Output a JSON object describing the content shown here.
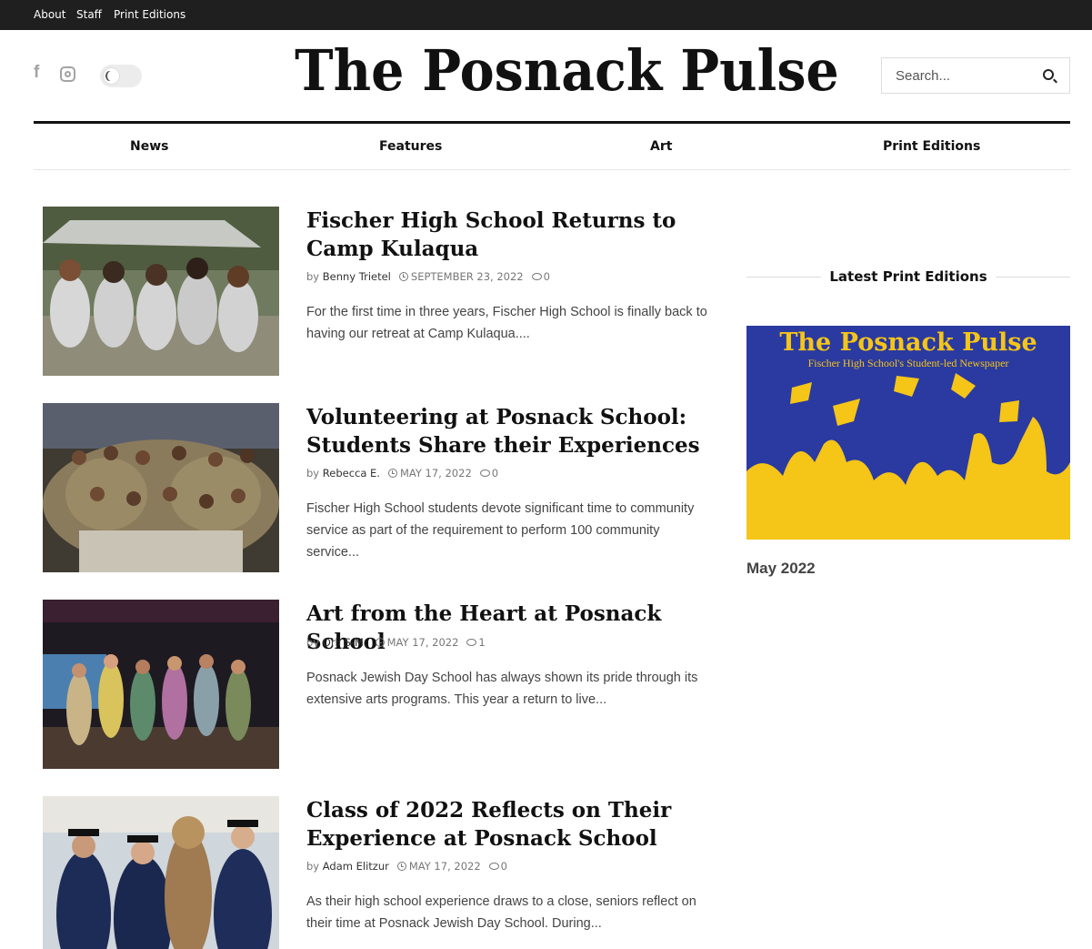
{
  "topbar": {
    "links": [
      "About",
      "Staff",
      "Print Editions"
    ]
  },
  "header": {
    "logo_text": "The Posnack Pulse",
    "search_placeholder": "Search...",
    "social_icons": [
      "facebook-icon",
      "instagram-icon"
    ],
    "dark_mode_toggle": "off"
  },
  "nav": {
    "items": [
      "News",
      "Features",
      "Art",
      "Print Editions"
    ]
  },
  "articles": [
    {
      "title": "Fischer High School Returns to Camp Kulaqua",
      "by": "by",
      "author": "Benny Trietel",
      "date": "SEPTEMBER 23, 2022",
      "comments": "0",
      "excerpt": "For the first time in three years, Fischer High School is finally back to having our retreat at Camp Kulaqua...."
    },
    {
      "title": "Volunteering at Posnack School: Students Share their Experiences",
      "by": "by",
      "author": "Rebecca E.",
      "date": "MAY 17, 2022",
      "comments": "0",
      "excerpt": "Fischer High School students devote significant time to community service as part of the requirement to perform 100 community service..."
    },
    {
      "title": "Art from the Heart at Posnack School",
      "by": "by",
      "author": "Orli S-M.",
      "date": "MAY 17, 2022",
      "comments": "1",
      "excerpt": "Posnack Jewish Day School has always shown its pride through its extensive arts programs. This year a return to live..."
    },
    {
      "title": "Class of 2022 Reflects on Their Experience at Posnack School",
      "by": "by",
      "author": "Adam Elitzur",
      "date": "MAY 17, 2022",
      "comments": "0",
      "excerpt": "As their high school experience draws to a close, seniors reflect on their time at Posnack Jewish Day School. During..."
    }
  ],
  "sidebar": {
    "widget_title": "Latest Print Editions",
    "cover_title": "The Posnack Pulse",
    "cover_subtitle": "Fischer High School's Student-led Newspaper",
    "edition_label": "May 2022"
  },
  "colors": {
    "topbar_bg": "#1f1f1f",
    "cover_bg": "#2a3aa0",
    "cover_accent": "#f5c518"
  }
}
